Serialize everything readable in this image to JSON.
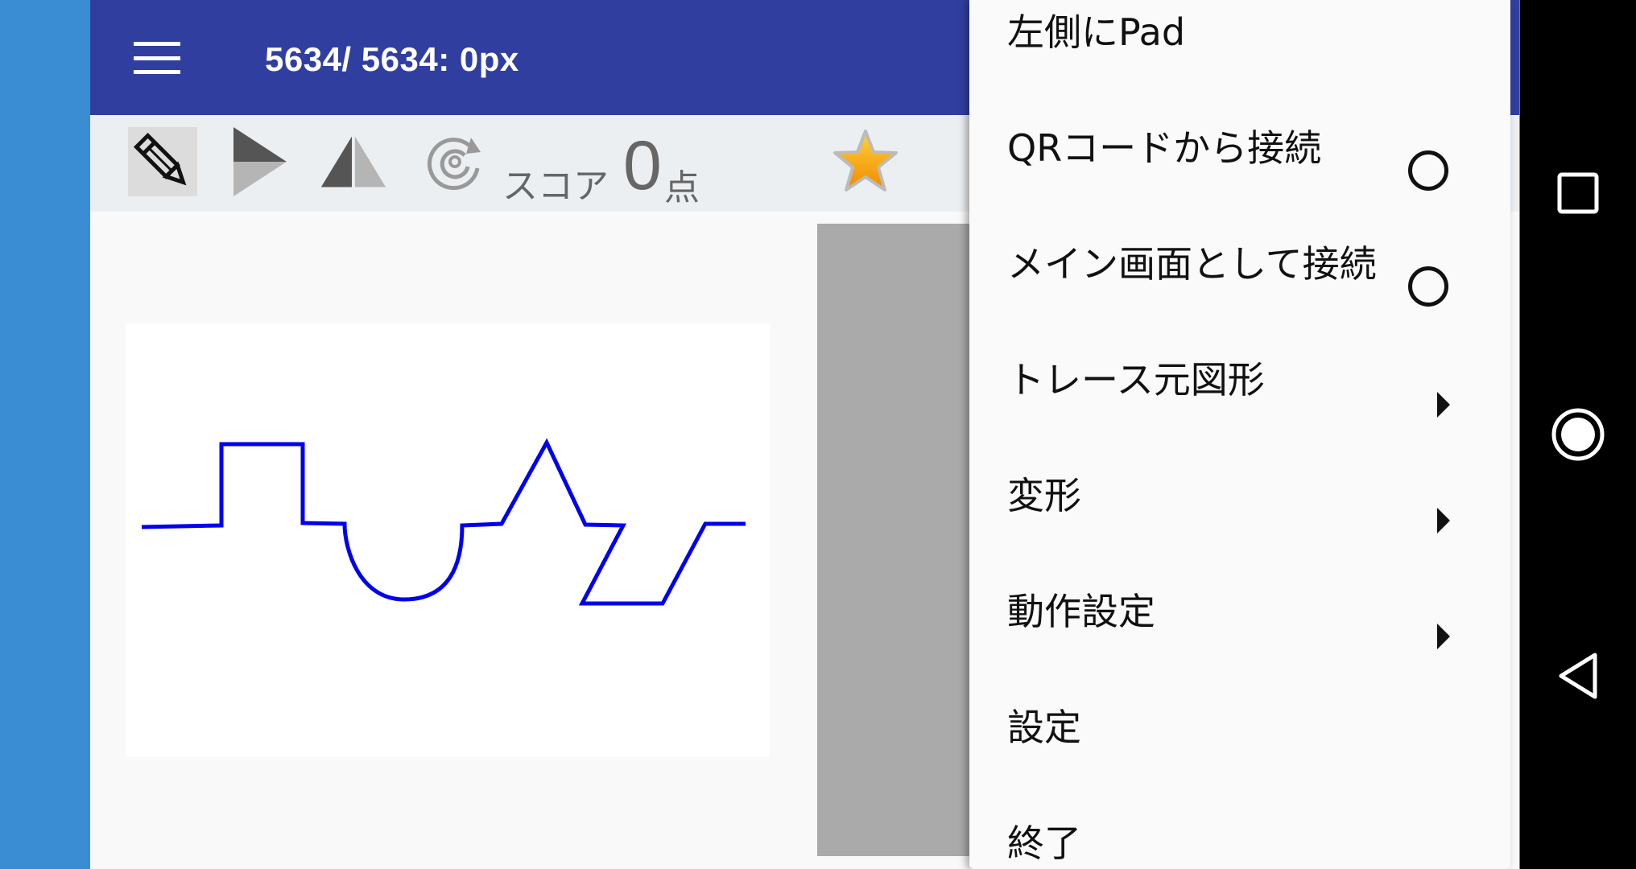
{
  "appbar": {
    "title": "5634/ 5634: 0px"
  },
  "toolbar": {
    "score_label": "スコア",
    "score_value": "0",
    "score_unit": "点"
  },
  "menu": {
    "items": [
      {
        "label": "左側にPad",
        "type": "plain"
      },
      {
        "label": "QRコードから接続",
        "type": "radio"
      },
      {
        "label": "メイン画面として接続",
        "type": "radio"
      },
      {
        "label": "トレース元図形",
        "type": "submenu"
      },
      {
        "label": "変形",
        "type": "submenu"
      },
      {
        "label": "動作設定",
        "type": "submenu"
      },
      {
        "label": "設定",
        "type": "plain"
      },
      {
        "label": "終了",
        "type": "plain"
      }
    ]
  },
  "colors": {
    "appbar": "#303f9f",
    "toolbar": "#eceff1",
    "stroke": "#0000ee",
    "gray_panel": "#aaaaaa",
    "side_strip": "#3a8dd3"
  },
  "icons": [
    "menu-icon",
    "pencil-icon",
    "play-icon",
    "mirror-icon",
    "rotate-icon",
    "star-icon",
    "square-nav-icon",
    "circle-nav-icon",
    "back-nav-icon"
  ]
}
